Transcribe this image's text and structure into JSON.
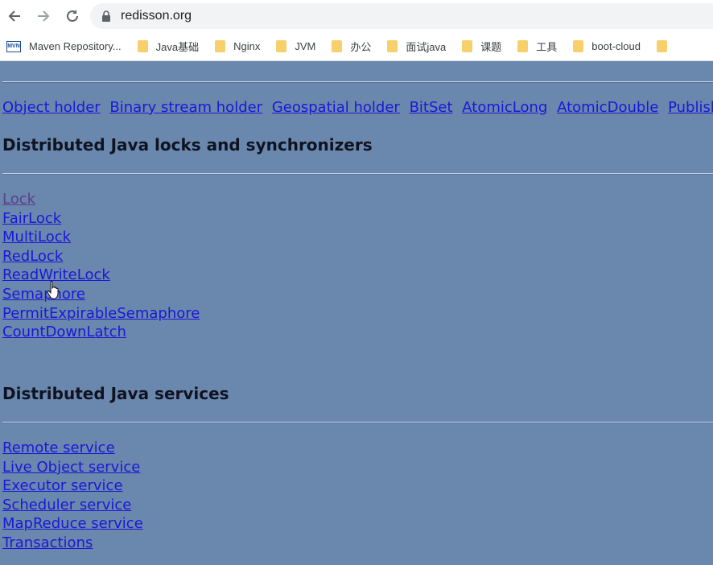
{
  "browser": {
    "url": "redisson.org",
    "bookmarks": [
      {
        "label": "Maven Repository...",
        "icon": "mvn-icon",
        "icon_text": "MVN"
      },
      {
        "label": "Java基础",
        "icon": "folder-icon"
      },
      {
        "label": "Nginx",
        "icon": "folder-icon"
      },
      {
        "label": "JVM",
        "icon": "folder-icon"
      },
      {
        "label": "办公",
        "icon": "folder-icon"
      },
      {
        "label": "面试java",
        "icon": "folder-icon"
      },
      {
        "label": "课题",
        "icon": "folder-icon"
      },
      {
        "label": "工具",
        "icon": "folder-icon"
      },
      {
        "label": "boot-cloud",
        "icon": "folder-icon"
      }
    ]
  },
  "content": {
    "inline_links": [
      "Object holder",
      "Binary stream holder",
      "Geospatial holder",
      "BitSet",
      "AtomicLong",
      "AtomicDouble",
      "PublishSubscri"
    ],
    "locks_heading": "Distributed Java locks and synchronizers",
    "locks_links": [
      "Lock",
      "FairLock",
      "MultiLock",
      "RedLock",
      "ReadWriteLock",
      "Semaphore",
      "PermitExpirableSemaphore",
      "CountDownLatch"
    ],
    "services_heading": "Distributed Java services",
    "services_links": [
      "Remote service",
      "Live Object service",
      "Executor service",
      "Scheduler service",
      "MapReduce service",
      "Transactions"
    ]
  },
  "colors": {
    "page_background": "#6a87ae",
    "link": "#1b18d6",
    "visited_link": "#5a3f8a",
    "heading": "#0f1320"
  }
}
